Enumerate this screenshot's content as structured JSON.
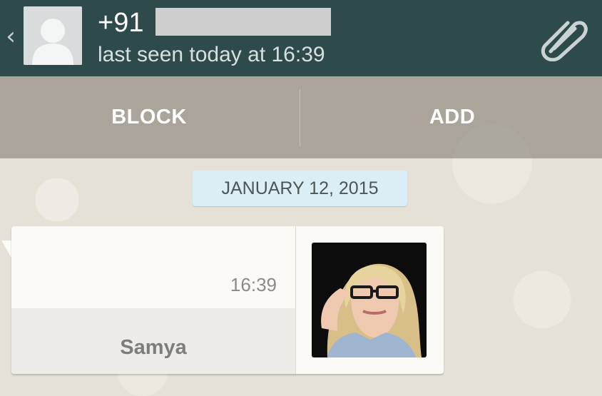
{
  "header": {
    "contact_prefix": "+91",
    "last_seen": "last seen today at 16:39",
    "back_icon": "chevron-left-icon",
    "avatar_icon": "default-avatar-icon",
    "attach_icon": "paperclip-icon"
  },
  "actions": {
    "block_label": "BLOCK",
    "add_label": "ADD"
  },
  "conversation": {
    "date_label": "JANUARY 12, 2015",
    "message": {
      "time": "16:39",
      "contact_name": "Samya",
      "attachment_type": "photo"
    }
  },
  "colors": {
    "appbar": "#2f4a4b",
    "date_chip": "#dbeef6",
    "bubble": "#fbfaf6"
  }
}
